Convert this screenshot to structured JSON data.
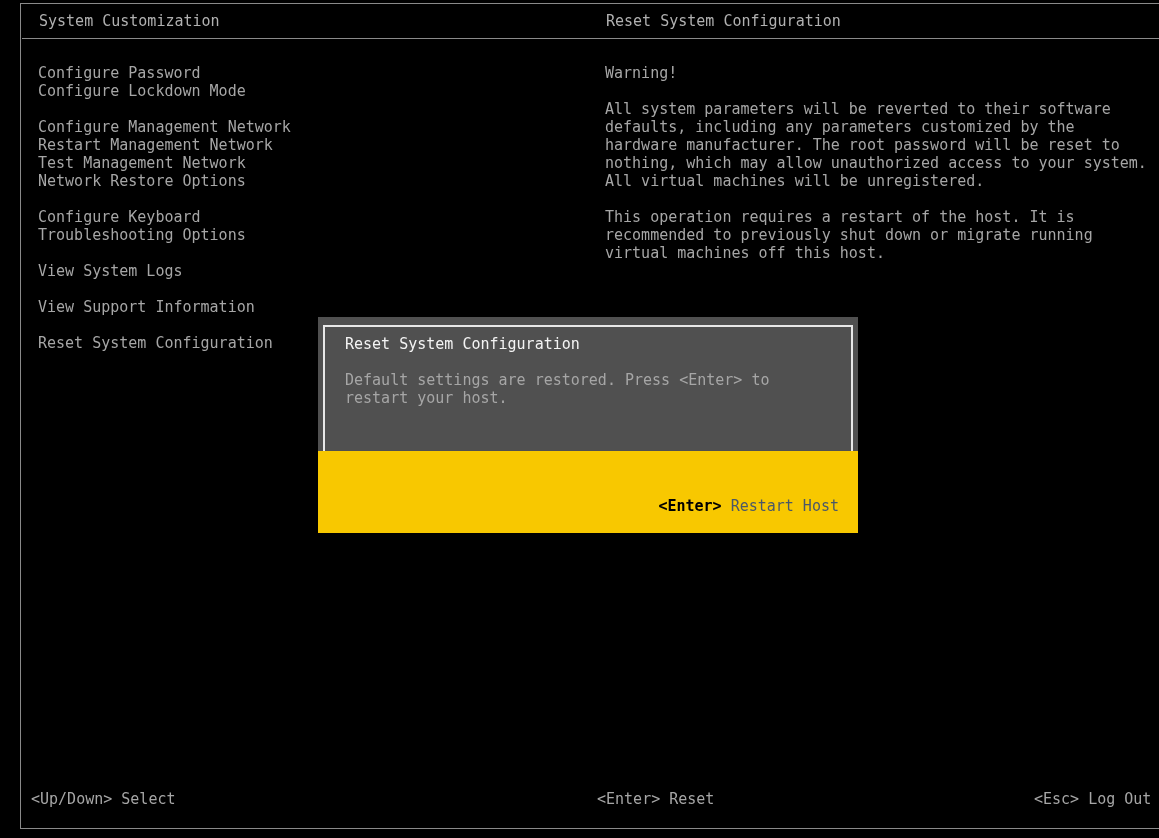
{
  "left_panel": {
    "title": "System Customization",
    "menu_groups": [
      {
        "items": [
          "Configure Password",
          "Configure Lockdown Mode"
        ]
      },
      {
        "items": [
          "Configure Management Network",
          "Restart Management Network",
          "Test Management Network",
          "Network Restore Options"
        ]
      },
      {
        "items": [
          "Configure Keyboard",
          "Troubleshooting Options"
        ]
      },
      {
        "items": [
          "View System Logs"
        ]
      },
      {
        "items": [
          "View Support Information"
        ]
      },
      {
        "items": [
          "Reset System Configuration"
        ]
      }
    ]
  },
  "right_panel": {
    "title": "Reset System Configuration",
    "warning": "Warning!",
    "paragraphs": [
      "All system parameters will be reverted to their software\ndefaults, including any parameters customized by the\nhardware manufacturer. The root password will be reset to\nnothing, which may allow unauthorized access to your system.\nAll virtual machines will be unregistered.",
      "This operation requires a restart of the host. It is\nrecommended to previously shut down or migrate running\nvirtual machines off this host."
    ]
  },
  "dialog": {
    "title": "Reset System Configuration",
    "message": "Default settings are restored. Press <Enter> to\nrestart your host.",
    "action": {
      "key": "<Enter>",
      "label": "Restart Host"
    }
  },
  "status_bar": [
    "<Up/Down> Select",
    "<Enter> Reset",
    "<Esc> Log Out"
  ]
}
